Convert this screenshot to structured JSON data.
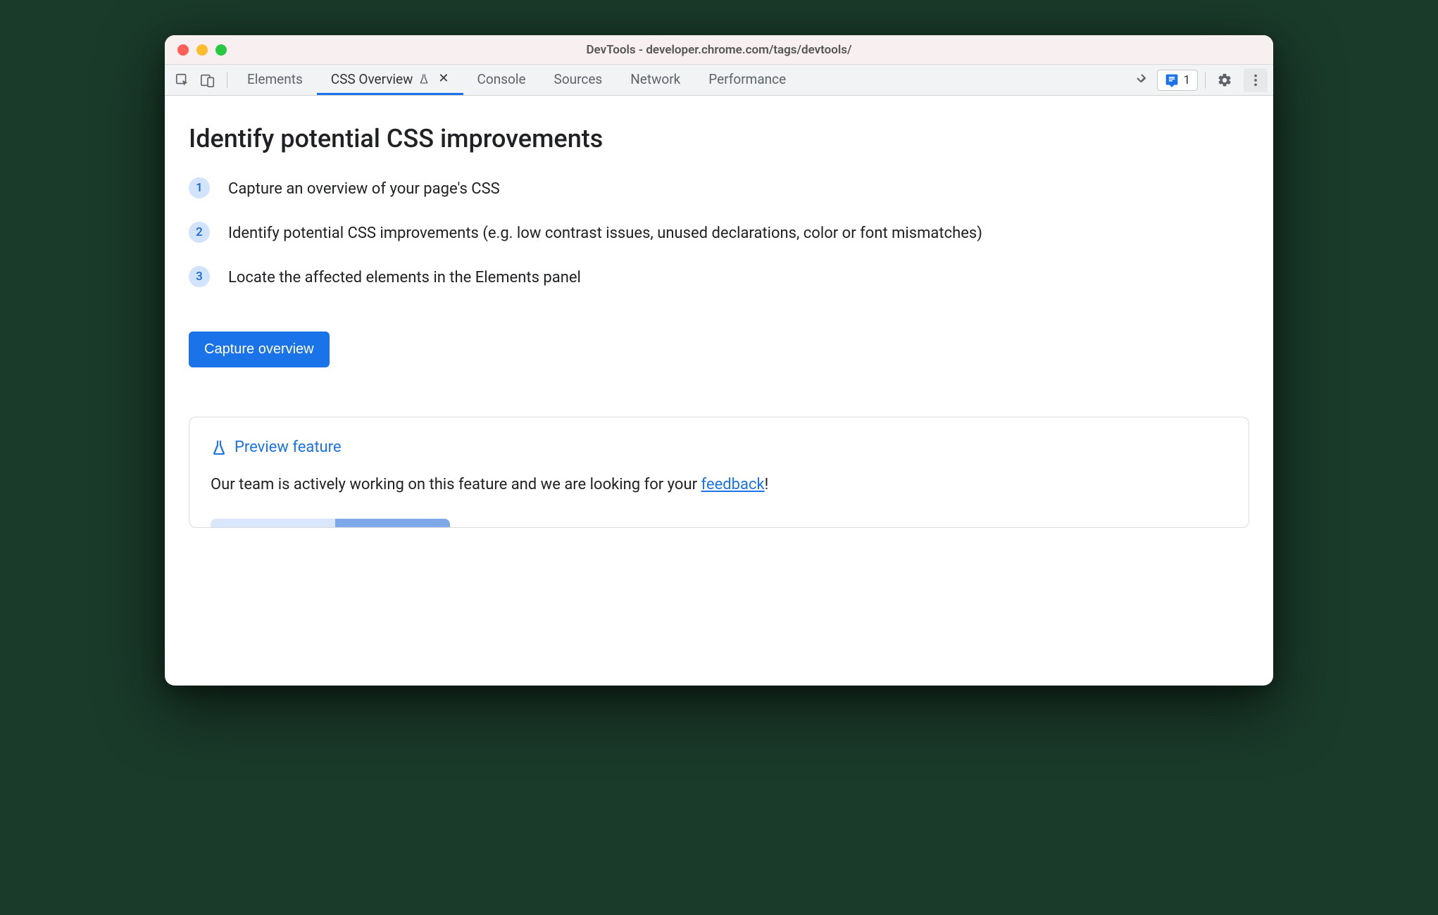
{
  "window": {
    "title": "DevTools - developer.chrome.com/tags/devtools/"
  },
  "tabs": {
    "items": [
      {
        "label": "Elements"
      },
      {
        "label": "CSS Overview"
      },
      {
        "label": "Console"
      },
      {
        "label": "Sources"
      },
      {
        "label": "Network"
      },
      {
        "label": "Performance"
      }
    ]
  },
  "issues": {
    "count": "1"
  },
  "main": {
    "heading": "Identify potential CSS improvements",
    "steps": [
      "Capture an overview of your page's CSS",
      "Identify potential CSS improvements (e.g. low contrast issues, unused declarations, color or font mismatches)",
      "Locate the affected elements in the Elements panel"
    ],
    "capture_button": "Capture overview"
  },
  "preview": {
    "title": "Preview feature",
    "body_prefix": "Our team is actively working on this feature and we are looking for your ",
    "link_text": "feedback",
    "body_suffix": "!"
  }
}
